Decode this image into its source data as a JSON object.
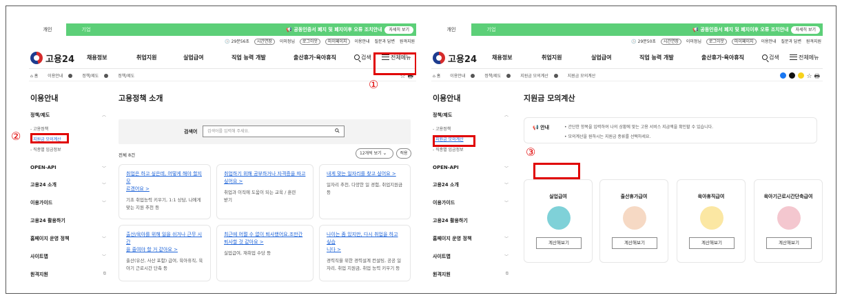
{
  "header": {
    "tabs": [
      "개인",
      "기업"
    ],
    "notice": "공동인증서 폐지 및 폐지이후 오류 조치안내",
    "notice_btn": "자세히 보기"
  },
  "left": {
    "util": {
      "timer": "29분56초",
      "extend": "시간연장",
      "user": "이미정님",
      "logout": "로그아웃",
      "mypage": "마이페이지",
      "guide": "이용안내",
      "faq": "질문과 답변",
      "remote": "원격지원"
    },
    "logo": "고용24",
    "nav": [
      "채용정보",
      "취업지원",
      "실업급여",
      "직업 능력 개발",
      "출산휴가·육아휴직"
    ],
    "search": "검색",
    "allmenu": "전체메뉴",
    "crumb": [
      "홈",
      "이용안내",
      "정책/제도",
      "정책/제도"
    ],
    "side_title": "이용안내",
    "side_sections": {
      "policy": "정책/제도",
      "sub1": "- 고용정책",
      "sub2": "- 지원금 모의계산",
      "sub3": "- 직종별 임금정보",
      "g1": "OPEN-API",
      "g2": "고용24 소개",
      "g3": "이용가이드",
      "g4": "고용24 활용하기",
      "g5": "홈페이지 운영 정책",
      "g6": "사이트맵",
      "g7": "원격지원"
    },
    "page_title": "고용정책 소개",
    "search_label": "검색어",
    "search_placeholder": "검색어를 입력해 주세요.",
    "total": "전체 8건",
    "per_page": "12개씩 보기",
    "apply": "적용",
    "cards": [
      {
        "l1": "취업은 하고 싶은데, 어떻게 해야 할지 모",
        "l2": "르겠어요 >",
        "d1": "기초 취업능력 키우기, 1:1 상담, 나에게",
        "d2": "맞는 지원 추천 등"
      },
      {
        "l1": "취업하기 위해 공부하거나 자격증을 따고",
        "l2": "싶어요 >",
        "d1": "취업과 이직에 도움이 되는 교육 / 훈련",
        "d2": "받기"
      },
      {
        "l1": "내게 맞는 일자리를 찾고 싶어요 >",
        "l2": "",
        "d1": "일자리 추천, 다양한 일 경험, 취업지원금",
        "d2": "등"
      },
      {
        "l1": "출산/육아를 위해 일을 쉬거나 근무 시간",
        "l2": "을 줄여야 할 거 같아요 >",
        "d1": "출산(유산, 사산 포함) 급여, 육아휴직, 육",
        "d2": "아기 근로시간 단축 등"
      },
      {
        "l1": "최근에 어쩔 수 없이 퇴사했어요.조만간",
        "l2": "퇴사할 것 같아요 >",
        "d1": "실업급여, 재취업 수당 등",
        "d2": ""
      },
      {
        "l1": "나이는 좀 있지만, 다시 취업을 하고 싶습",
        "l2": "니다 >",
        "d1": "경력직을 위한 경력설계 컨설팅, 공공 일",
        "d2": "자리, 취업 지원금, 취업 능력 키우기 등"
      }
    ]
  },
  "right": {
    "util": {
      "timer": "29분50초",
      "extend": "시간연장",
      "user": "이미정님",
      "logout": "로그아웃",
      "mypage": "마이페이지",
      "guide": "이용안내",
      "faq": "질문과 답변",
      "remote": "원격지원"
    },
    "logo": "고용24",
    "nav": [
      "채용정보",
      "취업지원",
      "실업급여",
      "직업 능력 개발",
      "출산휴가·육아휴직"
    ],
    "search": "검색",
    "allmenu": "전체메뉴",
    "crumb": [
      "홈",
      "이용안내",
      "정책/제도",
      "지원금 모의계산",
      "지원금 모의계산"
    ],
    "side_title": "이용안내",
    "side_sections": {
      "policy": "정책/제도",
      "sub1": "- 고용정책",
      "sub2": "- 지원금 모의계산",
      "sub3": "- 직종별 임금정보",
      "g1": "OPEN-API",
      "g2": "고용24 소개",
      "g3": "이용가이드",
      "g4": "고용24 활용하기",
      "g5": "홈페이지 운영 정책",
      "g6": "사이트맵",
      "g7": "원격지원"
    },
    "page_title": "지원금 모의계산",
    "info_tag": "안내",
    "info1": "• 간단한 항목을 입력하여 나의 상황에 맞는 고용 서비스 지급액을 확인할 수 있습니다.",
    "info2": "• 모의계산을 원하시는 지원금 종류를 선택하세요.",
    "benefits": [
      {
        "title": "실업급여",
        "btn": "계산해보기",
        "color": "#7fd1d8"
      },
      {
        "title": "출산휴가급여",
        "btn": "계산해보기",
        "color": "#f6d9c4"
      },
      {
        "title": "육아휴직급여",
        "btn": "계산해보기",
        "color": "#fbe7a3"
      },
      {
        "title": "육아기근로시간단축급여",
        "btn": "계산해보기",
        "color": "#f4c7cf"
      }
    ]
  },
  "annotations": {
    "n1": "①",
    "n2": "②",
    "n3": "③"
  }
}
